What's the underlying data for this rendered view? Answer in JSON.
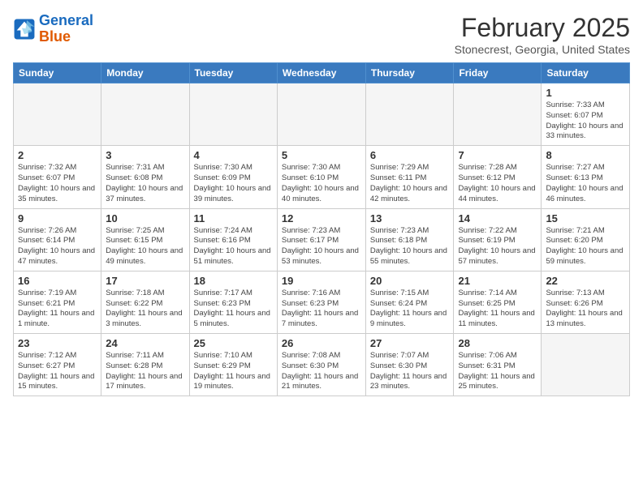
{
  "logo": {
    "line1": "General",
    "line2": "Blue"
  },
  "title": "February 2025",
  "location": "Stonecrest, Georgia, United States",
  "weekdays": [
    "Sunday",
    "Monday",
    "Tuesday",
    "Wednesday",
    "Thursday",
    "Friday",
    "Saturday"
  ],
  "weeks": [
    [
      {
        "day": "",
        "info": ""
      },
      {
        "day": "",
        "info": ""
      },
      {
        "day": "",
        "info": ""
      },
      {
        "day": "",
        "info": ""
      },
      {
        "day": "",
        "info": ""
      },
      {
        "day": "",
        "info": ""
      },
      {
        "day": "1",
        "info": "Sunrise: 7:33 AM\nSunset: 6:07 PM\nDaylight: 10 hours and 33 minutes."
      }
    ],
    [
      {
        "day": "2",
        "info": "Sunrise: 7:32 AM\nSunset: 6:07 PM\nDaylight: 10 hours and 35 minutes."
      },
      {
        "day": "3",
        "info": "Sunrise: 7:31 AM\nSunset: 6:08 PM\nDaylight: 10 hours and 37 minutes."
      },
      {
        "day": "4",
        "info": "Sunrise: 7:30 AM\nSunset: 6:09 PM\nDaylight: 10 hours and 39 minutes."
      },
      {
        "day": "5",
        "info": "Sunrise: 7:30 AM\nSunset: 6:10 PM\nDaylight: 10 hours and 40 minutes."
      },
      {
        "day": "6",
        "info": "Sunrise: 7:29 AM\nSunset: 6:11 PM\nDaylight: 10 hours and 42 minutes."
      },
      {
        "day": "7",
        "info": "Sunrise: 7:28 AM\nSunset: 6:12 PM\nDaylight: 10 hours and 44 minutes."
      },
      {
        "day": "8",
        "info": "Sunrise: 7:27 AM\nSunset: 6:13 PM\nDaylight: 10 hours and 46 minutes."
      }
    ],
    [
      {
        "day": "9",
        "info": "Sunrise: 7:26 AM\nSunset: 6:14 PM\nDaylight: 10 hours and 47 minutes."
      },
      {
        "day": "10",
        "info": "Sunrise: 7:25 AM\nSunset: 6:15 PM\nDaylight: 10 hours and 49 minutes."
      },
      {
        "day": "11",
        "info": "Sunrise: 7:24 AM\nSunset: 6:16 PM\nDaylight: 10 hours and 51 minutes."
      },
      {
        "day": "12",
        "info": "Sunrise: 7:23 AM\nSunset: 6:17 PM\nDaylight: 10 hours and 53 minutes."
      },
      {
        "day": "13",
        "info": "Sunrise: 7:23 AM\nSunset: 6:18 PM\nDaylight: 10 hours and 55 minutes."
      },
      {
        "day": "14",
        "info": "Sunrise: 7:22 AM\nSunset: 6:19 PM\nDaylight: 10 hours and 57 minutes."
      },
      {
        "day": "15",
        "info": "Sunrise: 7:21 AM\nSunset: 6:20 PM\nDaylight: 10 hours and 59 minutes."
      }
    ],
    [
      {
        "day": "16",
        "info": "Sunrise: 7:19 AM\nSunset: 6:21 PM\nDaylight: 11 hours and 1 minute."
      },
      {
        "day": "17",
        "info": "Sunrise: 7:18 AM\nSunset: 6:22 PM\nDaylight: 11 hours and 3 minutes."
      },
      {
        "day": "18",
        "info": "Sunrise: 7:17 AM\nSunset: 6:23 PM\nDaylight: 11 hours and 5 minutes."
      },
      {
        "day": "19",
        "info": "Sunrise: 7:16 AM\nSunset: 6:23 PM\nDaylight: 11 hours and 7 minutes."
      },
      {
        "day": "20",
        "info": "Sunrise: 7:15 AM\nSunset: 6:24 PM\nDaylight: 11 hours and 9 minutes."
      },
      {
        "day": "21",
        "info": "Sunrise: 7:14 AM\nSunset: 6:25 PM\nDaylight: 11 hours and 11 minutes."
      },
      {
        "day": "22",
        "info": "Sunrise: 7:13 AM\nSunset: 6:26 PM\nDaylight: 11 hours and 13 minutes."
      }
    ],
    [
      {
        "day": "23",
        "info": "Sunrise: 7:12 AM\nSunset: 6:27 PM\nDaylight: 11 hours and 15 minutes."
      },
      {
        "day": "24",
        "info": "Sunrise: 7:11 AM\nSunset: 6:28 PM\nDaylight: 11 hours and 17 minutes."
      },
      {
        "day": "25",
        "info": "Sunrise: 7:10 AM\nSunset: 6:29 PM\nDaylight: 11 hours and 19 minutes."
      },
      {
        "day": "26",
        "info": "Sunrise: 7:08 AM\nSunset: 6:30 PM\nDaylight: 11 hours and 21 minutes."
      },
      {
        "day": "27",
        "info": "Sunrise: 7:07 AM\nSunset: 6:30 PM\nDaylight: 11 hours and 23 minutes."
      },
      {
        "day": "28",
        "info": "Sunrise: 7:06 AM\nSunset: 6:31 PM\nDaylight: 11 hours and 25 minutes."
      },
      {
        "day": "",
        "info": ""
      }
    ]
  ]
}
